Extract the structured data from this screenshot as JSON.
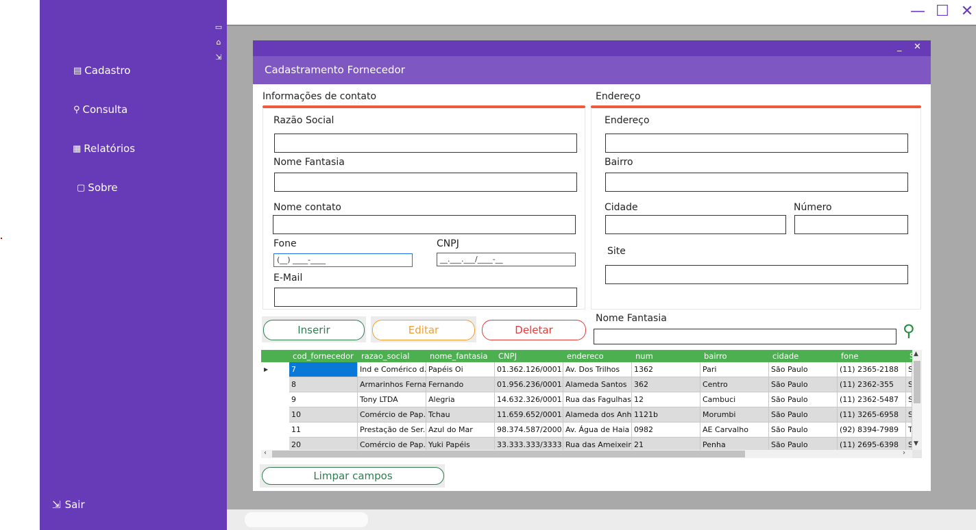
{
  "sidebar": {
    "top_icons": [
      "window-icon",
      "store-icon",
      "exit-icon"
    ],
    "items": [
      {
        "label": "Cadastro",
        "icon": "form-add-icon"
      },
      {
        "label": "Consulta",
        "icon": "search-icon"
      },
      {
        "label": "Relatórios",
        "icon": "report-icon"
      },
      {
        "label": "Sobre",
        "icon": "chat-icon"
      }
    ],
    "exit_label": "Sair"
  },
  "window": {
    "minimize": "—",
    "maximize": "☐",
    "close": "✕"
  },
  "dialog": {
    "title": "Cadastramento Fornecedor",
    "min": "_",
    "close": "✕",
    "contact": {
      "section_title": "Informações de contato",
      "razao_label": "Razão Social",
      "fantasia_label": "Nome Fantasia",
      "contato_label": "Nome contato",
      "fone_label": "Fone",
      "fone_mask": "(__) ____-____",
      "cnpj_label": "CNPJ",
      "cnpj_mask": "__.___.___/____-__",
      "email_label": "E-Mail"
    },
    "address": {
      "section_title": "Endereço",
      "endereco_label": "Endereço",
      "bairro_label": "Bairro",
      "cidade_label": "Cidade",
      "numero_label": "Número",
      "site_label": "Site"
    },
    "buttons": {
      "insert": "Inserir",
      "edit": "Editar",
      "delete": "Deletar",
      "clear": "Limpar campos"
    },
    "search": {
      "label": "Nome Fantasia",
      "icon": "search-icon"
    },
    "colors": {
      "sidebar": "#673ab7",
      "accent": "#f0593e",
      "grid_header": "#4caf50",
      "selected": "#0a78d7"
    }
  },
  "grid": {
    "columns": [
      "cod_fornecedor",
      "razao_social",
      "nome_fantasia",
      "CNPJ",
      "endereco",
      "num",
      "bairro",
      "cidade",
      "fone",
      "S"
    ],
    "rows": [
      [
        "7",
        "Ind e Comérico d...",
        "Papéis Oi",
        "01.362.126/0001...",
        "Av. Dos Trilhos",
        "1362",
        "Pari",
        "São Paulo",
        "(11) 2365-2188",
        "S"
      ],
      [
        "8",
        "Armarinhos Ferna...",
        "Fernando",
        "01.956.236/0001...",
        "Alameda Santos",
        "362",
        "Centro",
        "São Paulo",
        "(11) 2362-355",
        "S"
      ],
      [
        "9",
        "Tony LTDA",
        "Alegria",
        "14.632.326/0001...",
        "Rua das Fagulhas",
        "12",
        "Cambuci",
        "São Paulo",
        "(11) 2362-5487",
        "S"
      ],
      [
        "10",
        "Comércio de Pap...",
        "Tchau",
        "11.659.652/0001...",
        "Alameda dos Anh...",
        "1121b",
        "Morumbi",
        "São Paulo",
        "(11) 3265-6958",
        "S"
      ],
      [
        "11",
        "Prestação de Ser...",
        "Azul do Mar",
        "98.374.587/2000...",
        "Av. Água de Haia",
        "0982",
        "AE Carvalho",
        "São Paulo",
        "(92) 8394-7989",
        "T"
      ],
      [
        "20",
        "Comércio de Pap...",
        "Yuki Papéis",
        "33.333.333/3333...",
        "Rua das Ameixeir...",
        "21",
        "Penha",
        "São Paulo",
        "(11) 2695-6398",
        "S"
      ]
    ]
  }
}
